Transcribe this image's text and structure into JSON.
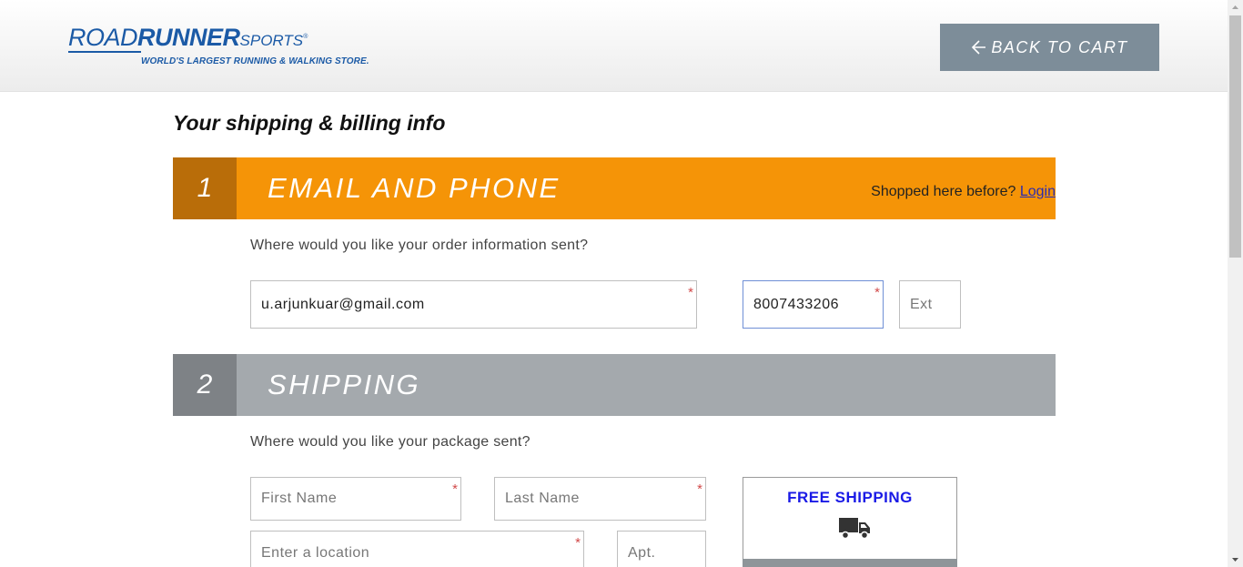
{
  "header": {
    "logo": {
      "road": "ROAD",
      "runner": "RUNNER",
      "sports": "SPORTS",
      "reg": "®",
      "tagline": "WORLD'S LARGEST RUNNING & WALKING STORE."
    },
    "back_to_cart": "BACK TO CART"
  },
  "page_title": "Your shipping & billing info",
  "sections": {
    "email_phone": {
      "number": "1",
      "title": "EMAIL AND PHONE",
      "login_prompt": "Shopped here before?",
      "login_link": "Login",
      "prompt": "Where would you like your order information sent?",
      "email_value": "u.arjunkuar@gmail.com",
      "phone_value": "8007433206",
      "ext_placeholder": "Ext",
      "required_marker": "*"
    },
    "shipping": {
      "number": "2",
      "title": "SHIPPING",
      "prompt": "Where would you like your package sent?",
      "first_name_placeholder": "First Name",
      "last_name_placeholder": "Last Name",
      "location_placeholder": "Enter a location",
      "apt_placeholder": "Apt.",
      "required_marker": "*",
      "free_shipping_label": "FREE SHIPPING",
      "free_shipping_icon": "truck-icon"
    }
  },
  "colors": {
    "brand_blue": "#1b5aa6",
    "section_active": "#f59407",
    "section_active_num": "#b96d09",
    "section_inactive": "#a4a9ad",
    "section_inactive_num": "#7e8286",
    "back_button": "#7d8d99",
    "free_shipping_text": "#1a1ae6"
  }
}
